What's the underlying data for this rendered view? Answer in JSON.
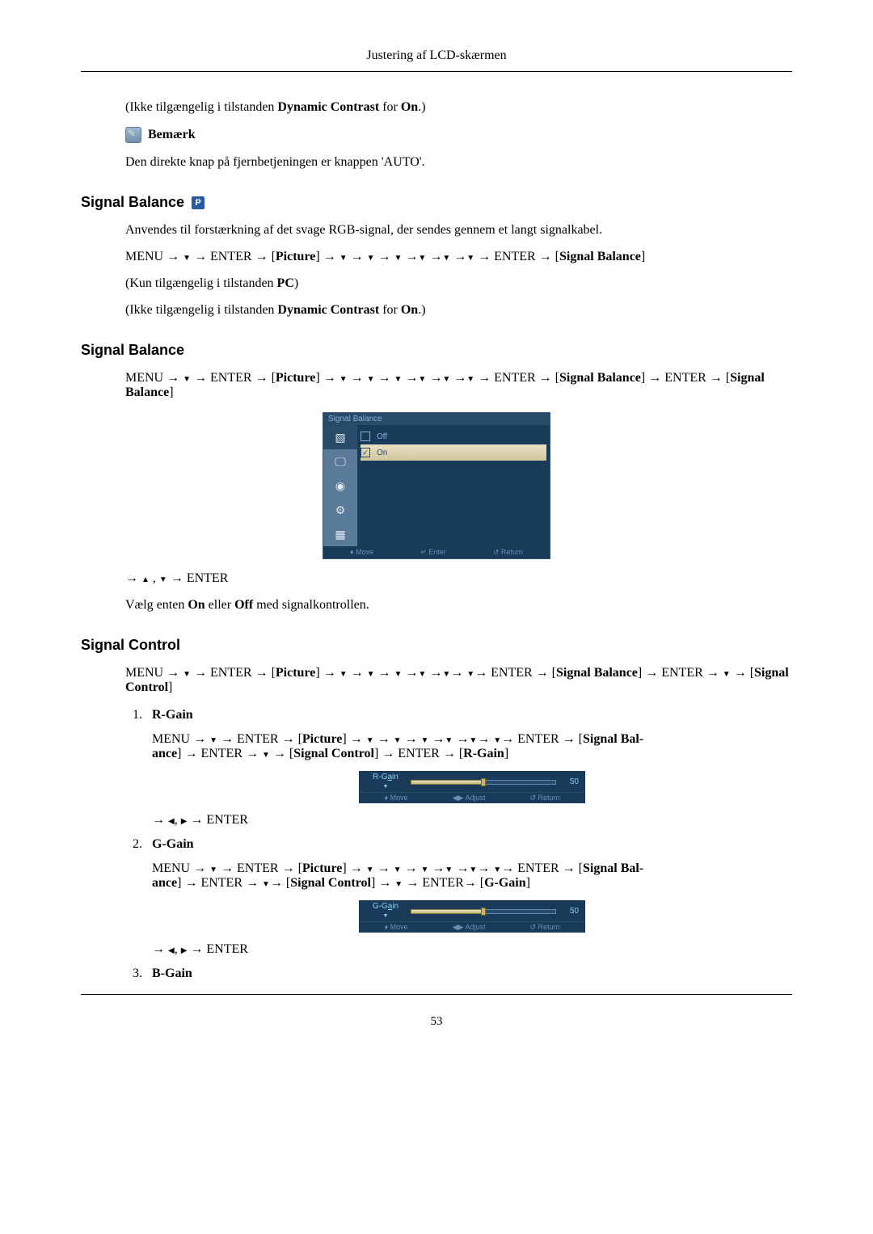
{
  "header": {
    "title": "Justering af LCD-skærmen"
  },
  "intro": {
    "para1_pre": "(Ikke tilgængelig i tilstanden ",
    "para1_bold": "Dynamic Contrast",
    "para1_mid": " for ",
    "para1_bold2": "On",
    "para1_post": ".)",
    "note_label": "Bemærk",
    "para2": "Den direkte knap på fjernbetjeningen er knappen 'AUTO'."
  },
  "section1": {
    "title": "Signal Balance",
    "p_icon": "P",
    "para1": "Anvendes til forstærkning af det svage RGB-signal, der sendes gennem et langt signalkabel.",
    "nav_menu": "MENU",
    "nav_enter": "ENTER",
    "nav_picture": "Picture",
    "nav_signal_balance": "Signal Balance",
    "para3_pre": "(Kun tilgængelig i tilstanden ",
    "para3_bold": "PC",
    "para3_post": ")",
    "para4_pre": "(Ikke tilgængelig i tilstanden ",
    "para4_bold": "Dynamic Contrast",
    "para4_mid": " for ",
    "para4_bold2": "On",
    "para4_post": ".)"
  },
  "section2": {
    "title": "Signal Balance",
    "nav_menu": "MENU",
    "nav_enter": "ENTER",
    "nav_picture": "Picture",
    "nav_signal_balance": "Signal Balance",
    "osd": {
      "header": "Signal Balance",
      "off": "Off",
      "on": "On",
      "move": "Move",
      "enter": "Enter",
      "return": "Return"
    },
    "post_nav": "ENTER",
    "para_pre": "Vælg enten ",
    "para_on": "On",
    "para_mid": " eller ",
    "para_off": "Off",
    "para_post": " med signalkontrollen."
  },
  "section3": {
    "title": "Signal Control",
    "nav_menu": "MENU",
    "nav_enter": "ENTER",
    "nav_picture": "Picture",
    "nav_signal_balance": "Signal Balance",
    "nav_signal_control": "Signal Control",
    "item1": {
      "title": "R-Gain",
      "nav_rgain": "R-Gain",
      "slider_label": "R-Gain",
      "slider_value": "50",
      "move": "Move",
      "adjust": "Adjust",
      "return": "Return"
    },
    "item2": {
      "title": "G-Gain",
      "nav_ggain": "G-Gain",
      "slider_label": "G-Gain",
      "slider_value": "50",
      "move": "Move",
      "adjust": "Adjust",
      "return": "Return"
    },
    "item3": {
      "title": "B-Gain"
    }
  },
  "footer": {
    "page": "53"
  }
}
